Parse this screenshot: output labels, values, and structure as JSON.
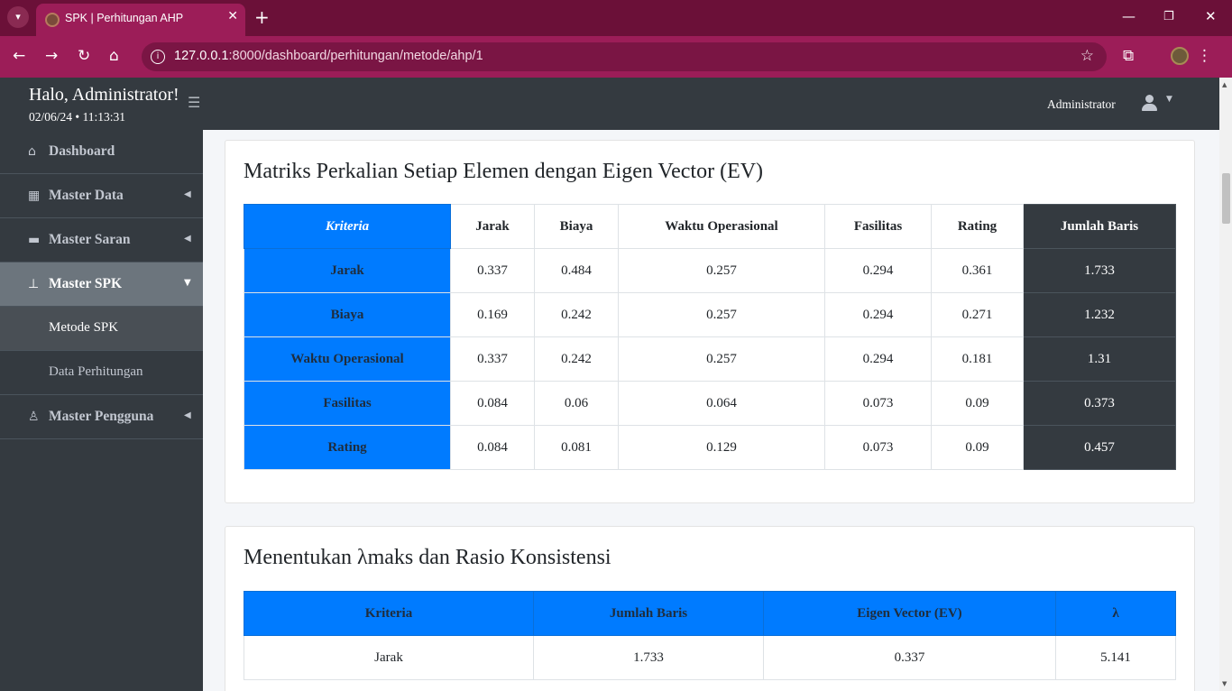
{
  "browser": {
    "tab_title": "SPK | Perhitungan AHP",
    "url_host": "127.0.0.1",
    "url_rest": ":8000/dashboard/perhitungan/metode/ahp/1"
  },
  "header": {
    "greeting": "Halo, Administrator!",
    "datetime": "02/06/24 • 11:13:31",
    "user_name": "Administrator"
  },
  "sidebar": {
    "items": [
      {
        "label": "Dashboard",
        "icon": "home-icon"
      },
      {
        "label": "Master Data",
        "icon": "cubes-icon"
      },
      {
        "label": "Master Saran",
        "icon": "comment-icon"
      },
      {
        "label": "Master SPK",
        "icon": "sitemap-icon"
      },
      {
        "label": "Metode SPK"
      },
      {
        "label": "Data Perhitungan"
      },
      {
        "label": "Master Pengguna",
        "icon": "users-cog-icon"
      }
    ]
  },
  "table1": {
    "title": "Matriks Perkalian Setiap Elemen dengan Eigen Vector (EV)",
    "headers": [
      "Kriteria",
      "Jarak",
      "Biaya",
      "Waktu Operasional",
      "Fasilitas",
      "Rating",
      "Jumlah Baris"
    ],
    "rows": [
      [
        "Jarak",
        "0.337",
        "0.484",
        "0.257",
        "0.294",
        "0.361",
        "1.733"
      ],
      [
        "Biaya",
        "0.169",
        "0.242",
        "0.257",
        "0.294",
        "0.271",
        "1.232"
      ],
      [
        "Waktu Operasional",
        "0.337",
        "0.242",
        "0.257",
        "0.294",
        "0.181",
        "1.31"
      ],
      [
        "Fasilitas",
        "0.084",
        "0.06",
        "0.064",
        "0.073",
        "0.09",
        "0.373"
      ],
      [
        "Rating",
        "0.084",
        "0.081",
        "0.129",
        "0.073",
        "0.09",
        "0.457"
      ]
    ]
  },
  "table2": {
    "title": "Menentukan λmaks dan Rasio Konsistensi",
    "headers": [
      "Kriteria",
      "Jumlah Baris",
      "Eigen Vector (EV)",
      "λ"
    ],
    "rows": [
      [
        "Jarak",
        "1.733",
        "0.337",
        "5.141"
      ]
    ]
  },
  "colors": {
    "accent_blue": "#007bff",
    "sidebar_dark": "#343a40",
    "browser_tab": "#9c1d58"
  }
}
